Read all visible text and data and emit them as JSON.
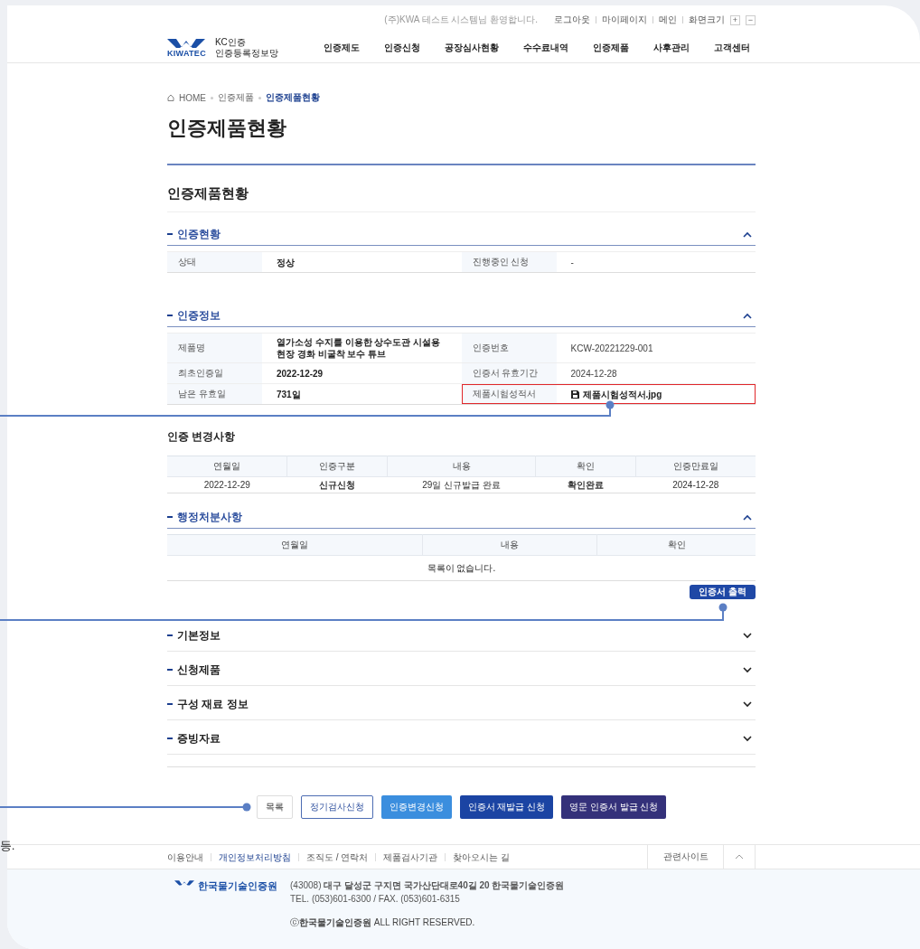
{
  "header": {
    "welcome": "(주)KWA 테스트 시스템님 환영합니다.",
    "util_links": [
      "로그아웃",
      "마이페이지",
      "메인"
    ],
    "font_size_label": "화면크기",
    "font_size_buttons": [
      "+",
      "−"
    ],
    "logo": {
      "mark": "KIWATEC",
      "line1": "KC인증",
      "line2": "인증등록정보망"
    },
    "nav": [
      "인증제도",
      "인증신청",
      "공장심사현황",
      "수수료내역",
      "인증제품",
      "사후관리",
      "고객센터"
    ]
  },
  "breadcrumb": [
    {
      "label": "HOME",
      "current": false
    },
    {
      "label": "인증제품",
      "current": false
    },
    {
      "label": "인증제품현황",
      "current": true
    }
  ],
  "page_title": "인증제품현황",
  "section_title": "인증제품현황",
  "panels": [
    {
      "kind": "kv",
      "title": "인증현황",
      "expanded": true,
      "rows": [
        {
          "label": "상태",
          "value": "정상",
          "label2": "진행중인 신청",
          "value2": "-",
          "highlighted": false
        }
      ]
    },
    {
      "kind": "kv",
      "title": "인증정보",
      "expanded": true,
      "rows": [
        {
          "label": "제품명",
          "value": "열가소성 수지를 이용한 상수도관 시설용 현장 경화 비굴착 보수 튜브",
          "label2": "인증번호",
          "value2": "KCW-20221229-001",
          "highlighted": false
        },
        {
          "label": "최초인증일",
          "value": "2022-12-29",
          "label2": "인증서 유효기간",
          "value2": "2024-12-28",
          "highlighted": false
        },
        {
          "label": "남은 유효일",
          "value": "731일",
          "label2": "제품시험성적서",
          "value2": "제품시험성적서.jpg",
          "file": true,
          "highlighted": true
        }
      ]
    },
    {
      "kind": "table",
      "title": "인증 변경사항",
      "columns": [
        "연월일",
        "인증구분",
        "내용",
        "확인",
        "인증만료일"
      ],
      "rows": [
        [
          "2022-12-29",
          "신규신청",
          "29일 신규발급 완료",
          "확인완료",
          "2024-12-28"
        ]
      ]
    },
    {
      "kind": "table",
      "title": "행정처분사항",
      "expanded": true,
      "columns": [
        "연월일",
        "내용",
        "확인"
      ],
      "empty_message": "목록이 없습니다.",
      "action": "인증서 출력"
    },
    {
      "kind": "section",
      "title": "기본정보",
      "expanded": false
    },
    {
      "kind": "section",
      "title": "신청제품",
      "expanded": false
    },
    {
      "kind": "section",
      "title": "구성 재료 정보",
      "expanded": false
    },
    {
      "kind": "section",
      "title": "증빙자료",
      "expanded": false
    }
  ],
  "buttons": [
    {
      "label": "목록",
      "kind": "plain"
    },
    {
      "label": "정기검사신청",
      "kind": "outline"
    },
    {
      "label": "인증변경신청",
      "kind": "light"
    },
    {
      "label": "인증서 재발급 신청",
      "kind": "primary"
    },
    {
      "label": "영문 인증서 발급 신청",
      "kind": "dark"
    }
  ],
  "edge_fragment": "등.",
  "footer": {
    "links": [
      {
        "label": "이용안내",
        "highlighted": false
      },
      {
        "label": "개인정보처리방침",
        "highlighted": true
      },
      {
        "label": "조직도 / 연락처",
        "highlighted": false
      },
      {
        "label": "제품검사기관",
        "highlighted": false
      },
      {
        "label": "찾아오시는 길",
        "highlighted": false
      }
    ],
    "related": "관련사이트",
    "org_name": "한국물기술인증원",
    "address": "(43008) **대구 달성군 구지면 국가산단대로40길 20 한국물기술인증원**",
    "contact": "TEL. (053)601-6300 / FAX. (053)601-6315",
    "copyright": "ⓒ**한국물기술인증원** ALL RIGHT RESERVED."
  }
}
